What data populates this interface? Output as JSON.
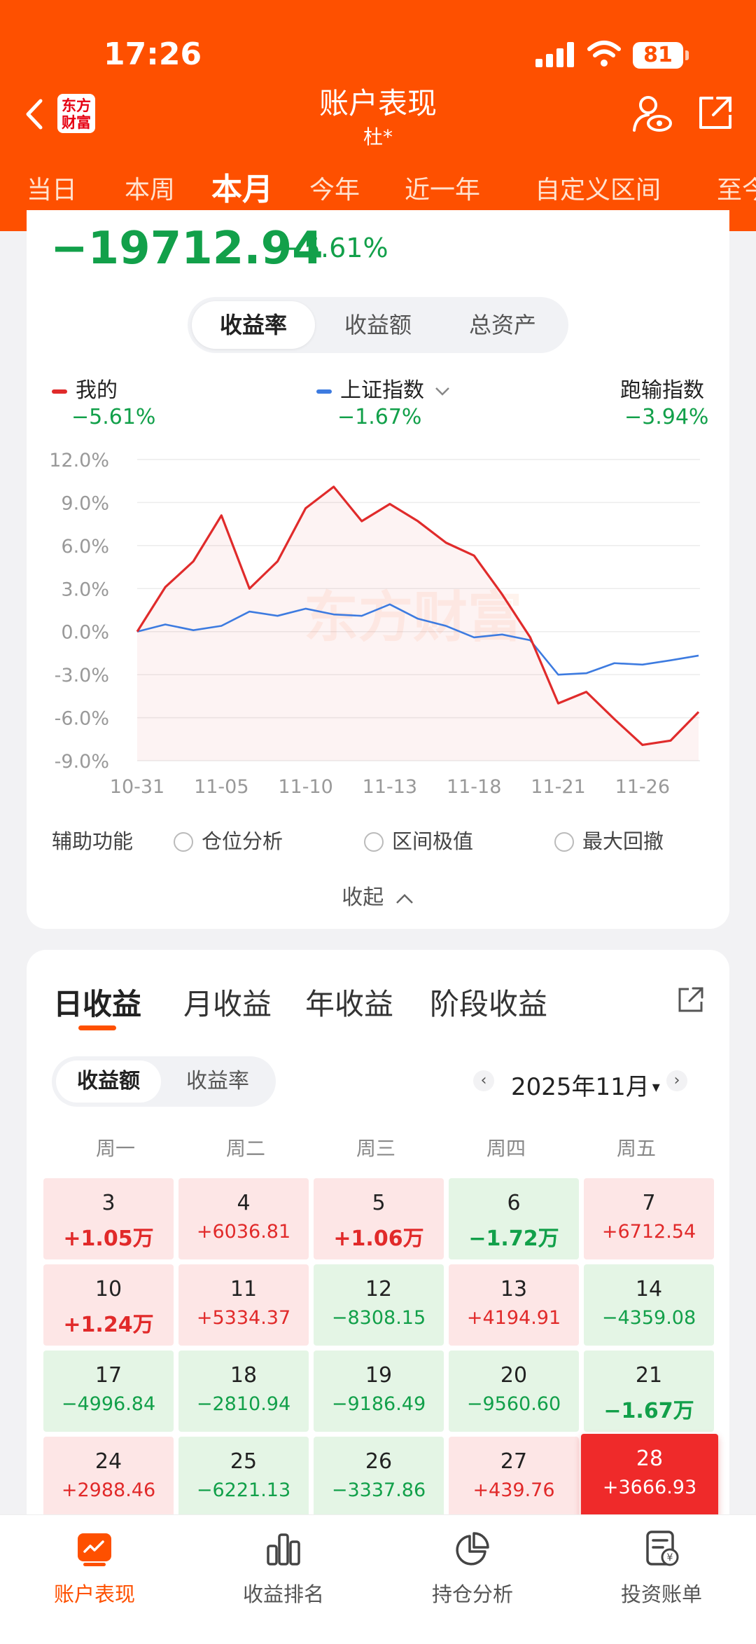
{
  "status": {
    "time": "17:26",
    "battery": "81"
  },
  "header": {
    "logo_line1": "东方",
    "logo_line2": "财富",
    "title": "账户表现",
    "subtitle": "杜*",
    "tabs": [
      "当日",
      "本周",
      "本月",
      "今年",
      "近一年",
      "自定义区间",
      "至今"
    ],
    "active_tab": "本月",
    "colors": {
      "brand": "#fe5000"
    }
  },
  "summary": {
    "profit": "−19712.94",
    "profit_pct": "−5.61%"
  },
  "chart_tabs": [
    "收益率",
    "收益额",
    "总资产"
  ],
  "legend": {
    "mine": {
      "label": "我的",
      "value": "−5.61%"
    },
    "index": {
      "label": "上证指数",
      "value": "−1.67%"
    },
    "lag": {
      "label": "跑输指数",
      "value": "−3.94%"
    }
  },
  "chart_data": {
    "type": "line",
    "x": [
      "10-31",
      "11-03",
      "11-04",
      "11-05",
      "11-06",
      "11-07",
      "11-10",
      "11-11",
      "11-12",
      "11-13",
      "11-14",
      "11-17",
      "11-18",
      "11-19",
      "11-20",
      "11-21",
      "11-24",
      "11-25",
      "11-26",
      "11-27",
      "11-28"
    ],
    "x_tick_labels": [
      "10-31",
      "11-05",
      "11-10",
      "11-13",
      "11-18",
      "11-21",
      "11-26"
    ],
    "y_tick_labels": [
      "12.0%",
      "9.0%",
      "6.0%",
      "3.0%",
      "0.0%",
      "-3.0%",
      "-6.0%",
      "-9.0%"
    ],
    "ylim": [
      -9,
      12
    ],
    "series": [
      {
        "name": "我的",
        "color": "#e02b2b",
        "values": [
          0,
          3.1,
          4.9,
          8.1,
          3.0,
          4.9,
          8.6,
          10.1,
          7.7,
          8.9,
          7.7,
          6.2,
          5.3,
          2.6,
          -0.4,
          -5.0,
          -4.2,
          -6.1,
          -7.9,
          -7.6,
          -5.6
        ]
      },
      {
        "name": "上证指数",
        "color": "#3d7be0",
        "values": [
          0,
          0.5,
          0.1,
          0.4,
          1.4,
          1.1,
          1.6,
          1.2,
          1.1,
          1.9,
          0.9,
          0.4,
          -0.4,
          -0.2,
          -0.6,
          -3.0,
          -2.9,
          -2.2,
          -2.3,
          -2.0,
          -1.67
        ]
      }
    ],
    "watermark": "东方财富"
  },
  "aux": {
    "label": "辅助功能",
    "options": [
      "仓位分析",
      "区间极值",
      "最大回撤"
    ]
  },
  "collapse_label": "收起",
  "profit_tabs": [
    "日收益",
    "月收益",
    "年收益",
    "阶段收益"
  ],
  "mode_tabs": [
    "收益额",
    "收益率"
  ],
  "month": "2025年11月",
  "weekdays": [
    "周一",
    "周二",
    "周三",
    "周四",
    "周五"
  ],
  "calendar": [
    {
      "day": "3",
      "value": "+1.05万",
      "dir": "up"
    },
    {
      "day": "4",
      "value": "+6036.81",
      "dir": "up"
    },
    {
      "day": "5",
      "value": "+1.06万",
      "dir": "up"
    },
    {
      "day": "6",
      "value": "−1.72万",
      "dir": "down"
    },
    {
      "day": "7",
      "value": "+6712.54",
      "dir": "up"
    },
    {
      "day": "10",
      "value": "+1.24万",
      "dir": "up"
    },
    {
      "day": "11",
      "value": "+5334.37",
      "dir": "up"
    },
    {
      "day": "12",
      "value": "−8308.15",
      "dir": "down"
    },
    {
      "day": "13",
      "value": "+4194.91",
      "dir": "up"
    },
    {
      "day": "14",
      "value": "−4359.08",
      "dir": "down"
    },
    {
      "day": "17",
      "value": "−4996.84",
      "dir": "down"
    },
    {
      "day": "18",
      "value": "−2810.94",
      "dir": "down"
    },
    {
      "day": "19",
      "value": "−9186.49",
      "dir": "down"
    },
    {
      "day": "20",
      "value": "−9560.60",
      "dir": "down"
    },
    {
      "day": "21",
      "value": "−1.67万",
      "dir": "down"
    },
    {
      "day": "24",
      "value": "+2988.46",
      "dir": "up"
    },
    {
      "day": "25",
      "value": "−6221.13",
      "dir": "down"
    },
    {
      "day": "26",
      "value": "−3337.86",
      "dir": "down"
    },
    {
      "day": "27",
      "value": "+439.76",
      "dir": "up"
    },
    {
      "day": "28",
      "value": "+3666.93",
      "dir": "up",
      "selected": true
    }
  ],
  "bottom_nav": [
    {
      "label": "账户表现",
      "icon": "chart-icon",
      "active": true
    },
    {
      "label": "收益排名",
      "icon": "bar-chart-icon"
    },
    {
      "label": "持仓分析",
      "icon": "pie-chart-icon"
    },
    {
      "label": "投资账单",
      "icon": "bill-icon"
    }
  ]
}
